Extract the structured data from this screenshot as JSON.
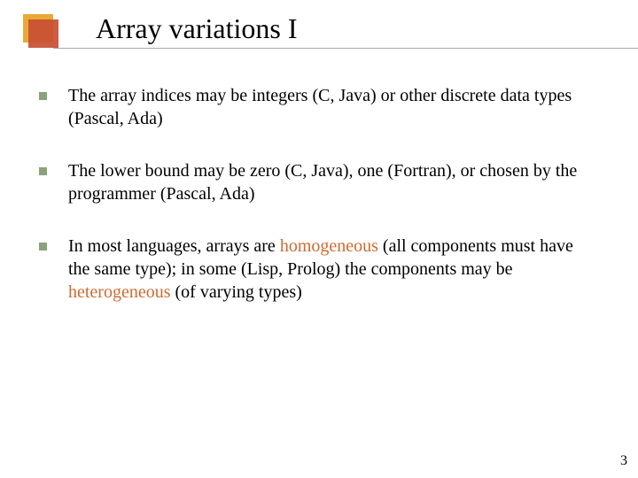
{
  "title": "Array variations I",
  "bullets": [
    {
      "pre": "The array indices may be integers (C, Java) or other discrete data types (Pascal, Ada)",
      "hl1": "",
      "mid": "",
      "hl2": "",
      "post": ""
    },
    {
      "pre": "The lower bound may be zero (C, Java), one (Fortran), or chosen by the programmer (Pascal, Ada)",
      "hl1": "",
      "mid": "",
      "hl2": "",
      "post": ""
    },
    {
      "pre": "In most languages, arrays are ",
      "hl1": "homogeneous",
      "mid": " (all components must have the same type); in some (Lisp, Prolog) the components may be ",
      "hl2": "heterogeneous",
      "post": " (of varying types)"
    }
  ],
  "page_number": "3"
}
